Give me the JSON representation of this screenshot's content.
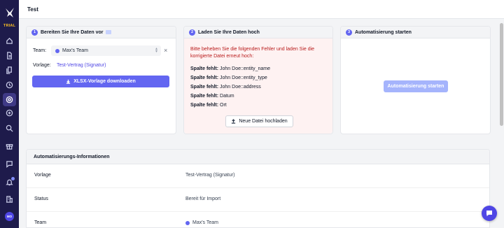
{
  "app": {
    "trial_badge": "TRIAL",
    "user_initials": "MO"
  },
  "topbar": {
    "title": "Test"
  },
  "nav": [
    "home-icon",
    "document-icon",
    "files-icon",
    "history-icon",
    "automation-icon",
    "settings-circle-icon",
    "search-icon",
    "gift-icon",
    "chat-icon",
    "bell-icon",
    "building-icon"
  ],
  "step1": {
    "num": "1",
    "title": "Bereiten Sie Ihre Daten vor",
    "team_label": "Team:",
    "team_value": "Max's Team",
    "template_label": "Vorlage:",
    "template_value": "Test-Vertrag (Signatur)",
    "download_button": "XLSX-Vorlage downloaden"
  },
  "step2": {
    "num": "2",
    "title": "Laden Sie Ihre Daten hoch",
    "error_intro": "Bitte beheben Sie die folgenden Fehler und laden Sie die korrigierte Datei erneut hoch:",
    "errors": [
      {
        "label": "Spalte fehlt:",
        "value": "John Doe::entity_name"
      },
      {
        "label": "Spalte fehlt:",
        "value": "John Doe::entity_type"
      },
      {
        "label": "Spalte fehlt:",
        "value": "John Doe::address"
      },
      {
        "label": "Spalte fehlt:",
        "value": "Datum"
      },
      {
        "label": "Spalte fehlt:",
        "value": "Ort"
      }
    ],
    "upload_button": "Neue Datei hochladen"
  },
  "step3": {
    "num": "3",
    "title": "Automatisierung starten",
    "start_button": "Automatisierung starten"
  },
  "info": {
    "title": "Automatisierungs-Informationen",
    "rows": [
      {
        "key": "Vorlage",
        "value": "Test-Vertrag (Signatur)"
      },
      {
        "key": "Status",
        "value": "Bereit für Import"
      },
      {
        "key": "Team",
        "value": "Max's Team"
      }
    ]
  },
  "colors": {
    "accent": "#6366f1",
    "sidebar": "#1e1b4b",
    "error_bg": "#fef2f2",
    "error_text": "#b91c1c"
  }
}
